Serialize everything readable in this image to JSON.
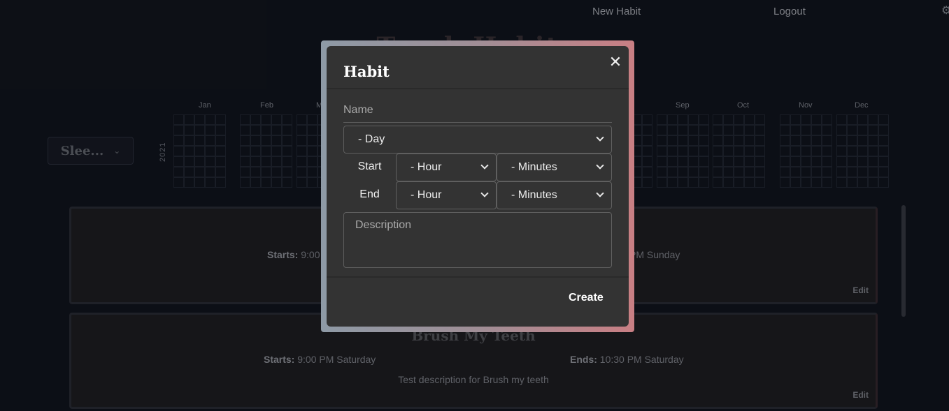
{
  "nav": {
    "new_habit": "New Habit",
    "logout": "Logout"
  },
  "page": {
    "title": "Track Habits"
  },
  "habit_select": {
    "value": "Slee..."
  },
  "calendar": {
    "year": "2021",
    "months": [
      "Jan",
      "Feb",
      "M",
      "Sep",
      "Oct",
      "Nov",
      "Dec"
    ]
  },
  "cards": [
    {
      "title": "",
      "starts_label": "Starts:",
      "starts_value": "9:00",
      "ends_label": "",
      "ends_value": "PM Sunday",
      "description": "",
      "edit": "Edit"
    },
    {
      "title": "Brush My Teeth",
      "starts_label": "Starts:",
      "starts_value": "9:00 PM Saturday",
      "ends_label": "Ends:",
      "ends_value": "10:30 PM Saturday",
      "description": "Test description for Brush my teeth",
      "edit": "Edit"
    }
  ],
  "modal": {
    "title": "Habit",
    "close": "✕",
    "name_placeholder": "Name",
    "day_select": "- Day",
    "start_label": "Start",
    "end_label": "End",
    "start_hour": "- Hour",
    "start_minutes": "- Minutes",
    "end_hour": "- Hour",
    "end_minutes": "- Minutes",
    "description_placeholder": "Description",
    "create": "Create"
  }
}
